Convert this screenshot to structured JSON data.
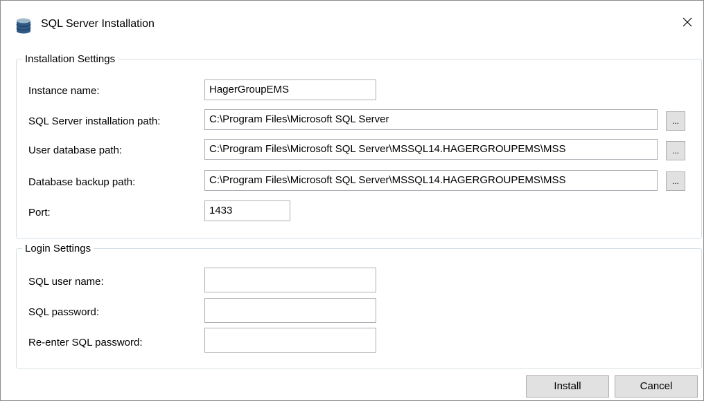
{
  "window": {
    "title": "SQL Server Installation",
    "icons": {
      "app": "database-icon",
      "close": "close-icon"
    }
  },
  "installation_settings": {
    "legend": "Installation Settings",
    "instance_name": {
      "label": "Instance name:",
      "value": "HagerGroupEMS"
    },
    "install_path": {
      "label": "SQL Server installation path:",
      "value": "C:\\Program Files\\Microsoft SQL Server",
      "browse": "..."
    },
    "user_db_path": {
      "label": "User database path:",
      "value": "C:\\Program Files\\Microsoft SQL Server\\MSSQL14.HAGERGROUPEMS\\MSS",
      "browse": "..."
    },
    "backup_path": {
      "label": "Database backup path:",
      "value": "C:\\Program Files\\Microsoft SQL Server\\MSSQL14.HAGERGROUPEMS\\MSS",
      "browse": "..."
    },
    "port": {
      "label": "Port:",
      "value": "1433"
    }
  },
  "login_settings": {
    "legend": "Login Settings",
    "user_name": {
      "label": "SQL user name:",
      "value": ""
    },
    "password": {
      "label": "SQL password:",
      "value": ""
    },
    "password_confirm": {
      "label": "Re-enter SQL password:",
      "value": ""
    }
  },
  "buttons": {
    "install": "Install",
    "cancel": "Cancel"
  },
  "colors": {
    "group_border": "#d5dfe5",
    "textbox_border": "#abadb3",
    "button_face": "#e1e1e1",
    "icon_blue": "#2f5a86"
  }
}
